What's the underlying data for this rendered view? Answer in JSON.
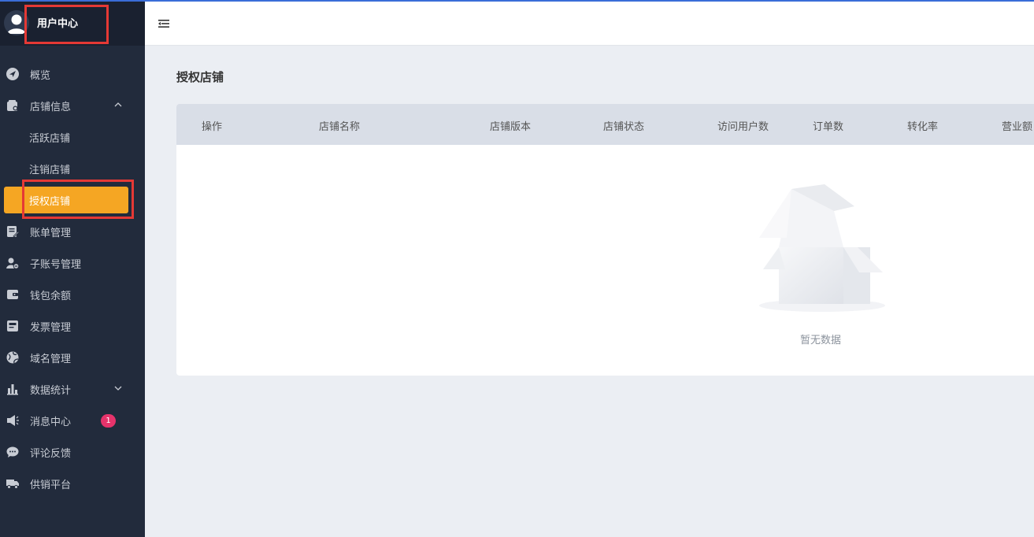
{
  "app": {
    "title": "用户中心"
  },
  "sidebar": {
    "items": [
      {
        "label": "概览",
        "icon": "navigation-icon"
      },
      {
        "label": "店铺信息",
        "icon": "store-icon",
        "expanded": true,
        "children": [
          {
            "label": "活跃店铺"
          },
          {
            "label": "注销店铺"
          },
          {
            "label": "授权店铺",
            "active": true
          }
        ]
      },
      {
        "label": "账单管理",
        "icon": "bill-edit-icon"
      },
      {
        "label": "子账号管理",
        "icon": "user-account-icon"
      },
      {
        "label": "钱包余额",
        "icon": "wallet-icon"
      },
      {
        "label": "发票管理",
        "icon": "invoice-icon"
      },
      {
        "label": "域名管理",
        "icon": "globe-icon"
      },
      {
        "label": "数据统计",
        "icon": "bar-chart-icon",
        "expanded": false
      },
      {
        "label": "消息中心",
        "icon": "speaker-icon",
        "badge": "1"
      },
      {
        "label": "评论反馈",
        "icon": "comment-icon"
      },
      {
        "label": "供销平台",
        "icon": "truck-icon"
      }
    ]
  },
  "main": {
    "title": "授权店铺",
    "table": {
      "columns": [
        "操作",
        "店铺名称",
        "店铺版本",
        "店铺状态",
        "访问用户数",
        "订单数",
        "转化率",
        "营业额"
      ],
      "rows": []
    },
    "empty_text": "暂无数据"
  },
  "colors": {
    "sidebar_bg": "#222b3c",
    "active_bg": "#f5a623",
    "highlight_border": "#e53935",
    "badge_bg": "#e6336b"
  }
}
